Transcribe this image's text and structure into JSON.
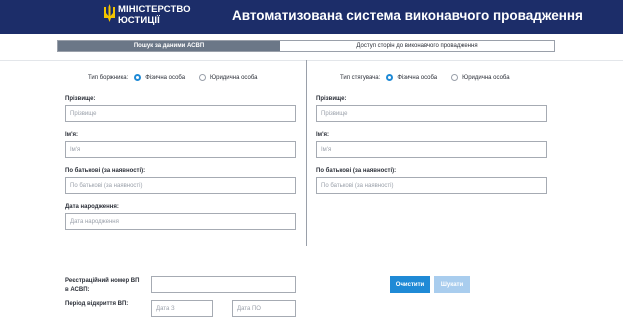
{
  "header": {
    "ministry_line1": "МІНІСТЕРСТВО",
    "ministry_line2": "ЮСТИЦІЇ",
    "app_title": "Автоматизована система виконавчого провадження",
    "logo_icon": "trident-icon"
  },
  "tabs": [
    {
      "label": "Пошук за даними АСВП",
      "active": true
    },
    {
      "label": "Доступ сторін до виконавчого провадження",
      "active": false
    }
  ],
  "debtor": {
    "type_label": "Тип боржника:",
    "options": [
      "Фізична особа",
      "Юридична особа"
    ],
    "selected": "Фізична особа",
    "fields": [
      {
        "label": "Прізвище:",
        "placeholder": "Прізвище"
      },
      {
        "label": "Ім'я:",
        "placeholder": "Ім'я"
      },
      {
        "label": "По батькові (за наявності):",
        "placeholder": "По батькові (за наявності)"
      },
      {
        "label": "Дата народження:",
        "placeholder": "Дата народження"
      }
    ]
  },
  "creditor": {
    "type_label": "Тип стягувача:",
    "options": [
      "Фізична особа",
      "Юридична особа"
    ],
    "selected": "Фізична особа",
    "fields": [
      {
        "label": "Прізвище:",
        "placeholder": "Прізвище"
      },
      {
        "label": "Ім'я:",
        "placeholder": "Ім'я"
      },
      {
        "label": "По батькові (за наявності):",
        "placeholder": "По батькові (за наявності)"
      }
    ]
  },
  "bottom": {
    "reg_label_line1": "Реєстраційний номер ВП",
    "reg_label_line2": "в АСВП:",
    "reg_value": "",
    "period_label": "Період відкриття ВП:",
    "date_from_placeholder": "Дата З",
    "date_to_placeholder": "Дата ПО"
  },
  "buttons": {
    "clear": "Очистити",
    "search": "Шукати"
  },
  "colors": {
    "header_bg": "#1c2d69",
    "accent": "#1f8ad6",
    "tab_active_bg": "#6b7787",
    "button_disabled": "#a9cdee"
  }
}
